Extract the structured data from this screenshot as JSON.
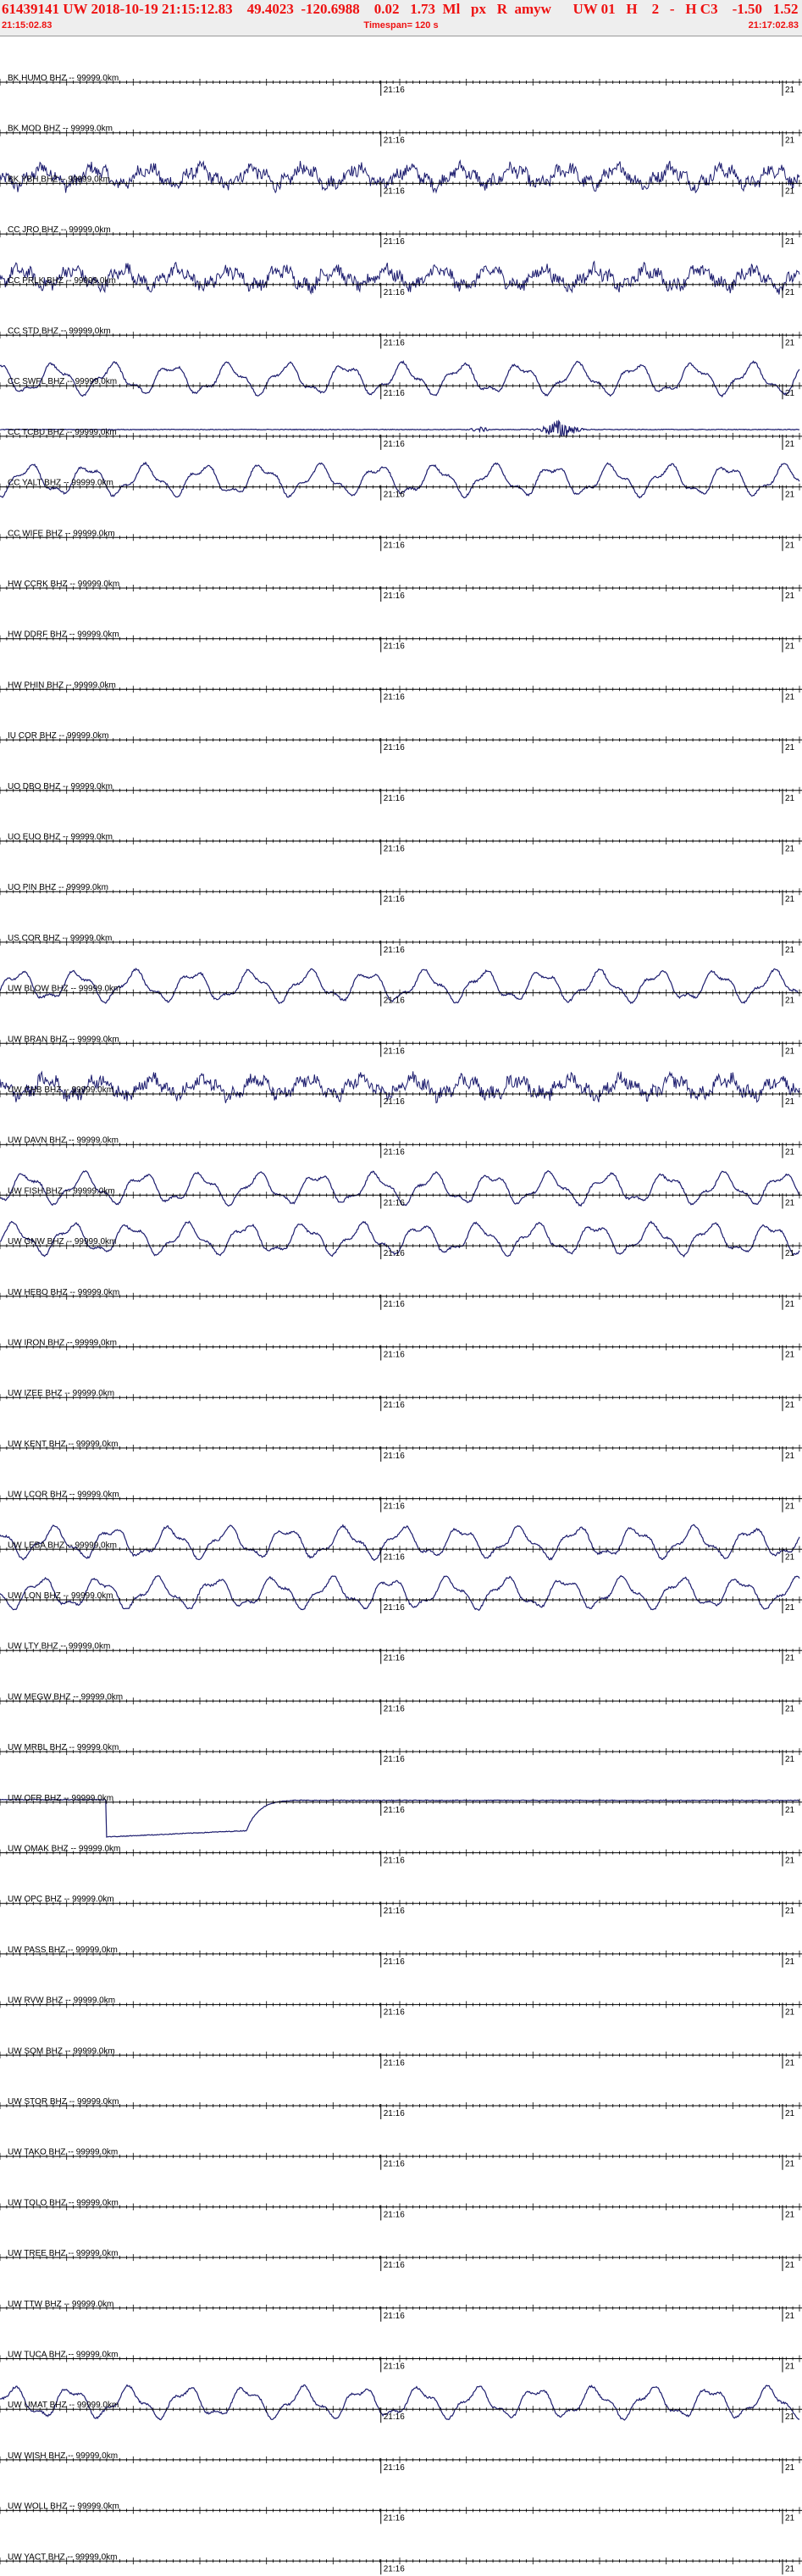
{
  "header": {
    "title": "61439141 UW 2018-10-19 21:15:12.83    49.4023  -120.6988    0.02   1.73  Ml   px   R  amyw      UW 01   H    2   -   H C3    -1.50   1.52",
    "start_time": "21:15:02.83",
    "timespan": "Timespan= 120 s",
    "end_time": "21:17:02.83"
  },
  "chart_data": {
    "type": "line",
    "x_unit": "s",
    "xlim": [
      0,
      120
    ],
    "tick_label": "21:16",
    "edge_tick_label": "21",
    "colors": {
      "trace": "#1c1c6e",
      "axis": "#000000",
      "title": "#ee1111",
      "label": "#000000"
    },
    "stations": [
      {
        "label": "BK HUMO BHZ -- 99999.0km",
        "trace": "flat"
      },
      {
        "label": "BK MOD BHZ -- 99999.0km",
        "trace": "flat"
      },
      {
        "label": "BK YBH BHZ -- 99999.0km",
        "trace": "noisy"
      },
      {
        "label": "CC JRO BHZ -- 99999.0km",
        "trace": "flat"
      },
      {
        "label": "CC PRLK BHZ -- 99999.0km",
        "trace": "noisy"
      },
      {
        "label": "CC STD BHZ -- 99999.0km",
        "trace": "flat"
      },
      {
        "label": "CC SWFL BHZ -- 99999.0km",
        "trace": "wave"
      },
      {
        "label": "CC TCBU BHZ -- 99999.0km",
        "trace": "burst"
      },
      {
        "label": "CC YALT BHZ -- 99999.0km",
        "trace": "wave"
      },
      {
        "label": "CC WIFE BHZ -- 99999.0km",
        "trace": "flat"
      },
      {
        "label": "HW CCRK BHZ -- 99999.0km",
        "trace": "flat"
      },
      {
        "label": "HW DDRF BHZ -- 99999.0km",
        "trace": "flat"
      },
      {
        "label": "HW PHIN BHZ -- 99999.0km",
        "trace": "flat"
      },
      {
        "label": "IU COR BHZ -- 99999.0km",
        "trace": "flat"
      },
      {
        "label": "UO DBO BHZ -- 99999.0km",
        "trace": "flat"
      },
      {
        "label": "UO EUO BHZ -- 99999.0km",
        "trace": "flat"
      },
      {
        "label": "UO PIN BHZ -- 99999.0km",
        "trace": "flat"
      },
      {
        "label": "US COR BHZ -- 99999.0km",
        "trace": "flat"
      },
      {
        "label": "UW BLOW BHZ -- 99999.0km",
        "trace": "wave"
      },
      {
        "label": "UW BRAN BHZ -- 99999.0km",
        "trace": "flat"
      },
      {
        "label": "UW CHB BHZ -- 99999.0km",
        "trace": "noisy"
      },
      {
        "label": "UW DAVN BHZ -- 99999.0km",
        "trace": "flat"
      },
      {
        "label": "UW FISH BHZ -- 99999.0km",
        "trace": "wave"
      },
      {
        "label": "UW GNW BHZ -- 99999.0km",
        "trace": "wave"
      },
      {
        "label": "UW HEBO BHZ -- 99999.0km",
        "trace": "flat"
      },
      {
        "label": "UW IRON BHZ -- 99999.0km",
        "trace": "flat"
      },
      {
        "label": "UW IZEE BHZ -- 99999.0km",
        "trace": "flat"
      },
      {
        "label": "UW KENT BHZ -- 99999.0km",
        "trace": "flat"
      },
      {
        "label": "UW LCOR BHZ -- 99999.0km",
        "trace": "flat"
      },
      {
        "label": "UW LEBA BHZ -- 99999.0km",
        "trace": "wave"
      },
      {
        "label": "UW LON BHZ -- 99999.0km",
        "trace": "wave"
      },
      {
        "label": "UW LTY BHZ -- 99999.0km",
        "trace": "flat"
      },
      {
        "label": "UW MEGW BHZ -- 99999.0km",
        "trace": "flat"
      },
      {
        "label": "UW MRBL BHZ -- 99999.0km",
        "trace": "flat"
      },
      {
        "label": "UW OFR BHZ -- 99999.0km",
        "trace": "step"
      },
      {
        "label": "UW OMAK BHZ -- 99999.0km",
        "trace": "flat"
      },
      {
        "label": "UW OPC BHZ -- 99999.0km",
        "trace": "flat"
      },
      {
        "label": "UW PASS BHZ -- 99999.0km",
        "trace": "flat"
      },
      {
        "label": "UW RVW BHZ -- 99999.0km",
        "trace": "flat"
      },
      {
        "label": "UW SQM BHZ -- 99999.0km",
        "trace": "flat"
      },
      {
        "label": "UW STOR BHZ -- 99999.0km",
        "trace": "flat"
      },
      {
        "label": "UW TAKO BHZ -- 99999.0km",
        "trace": "flat"
      },
      {
        "label": "UW TOLO BHZ -- 99999.0km",
        "trace": "flat"
      },
      {
        "label": "UW TREE BHZ -- 99999.0km",
        "trace": "flat"
      },
      {
        "label": "UW TTW BHZ -- 99999.0km",
        "trace": "flat"
      },
      {
        "label": "UW TUCA BHZ -- 99999.0km",
        "trace": "flat"
      },
      {
        "label": "UW UMAT BHZ -- 99999.0km",
        "trace": "wave"
      },
      {
        "label": "UW WISH BHZ -- 99999.0km",
        "trace": "flat"
      },
      {
        "label": "UW WOLL BHZ -- 99999.0km",
        "trace": "flat"
      },
      {
        "label": "UW YACT BHZ -- 99999.0km",
        "trace": "flat"
      }
    ]
  }
}
